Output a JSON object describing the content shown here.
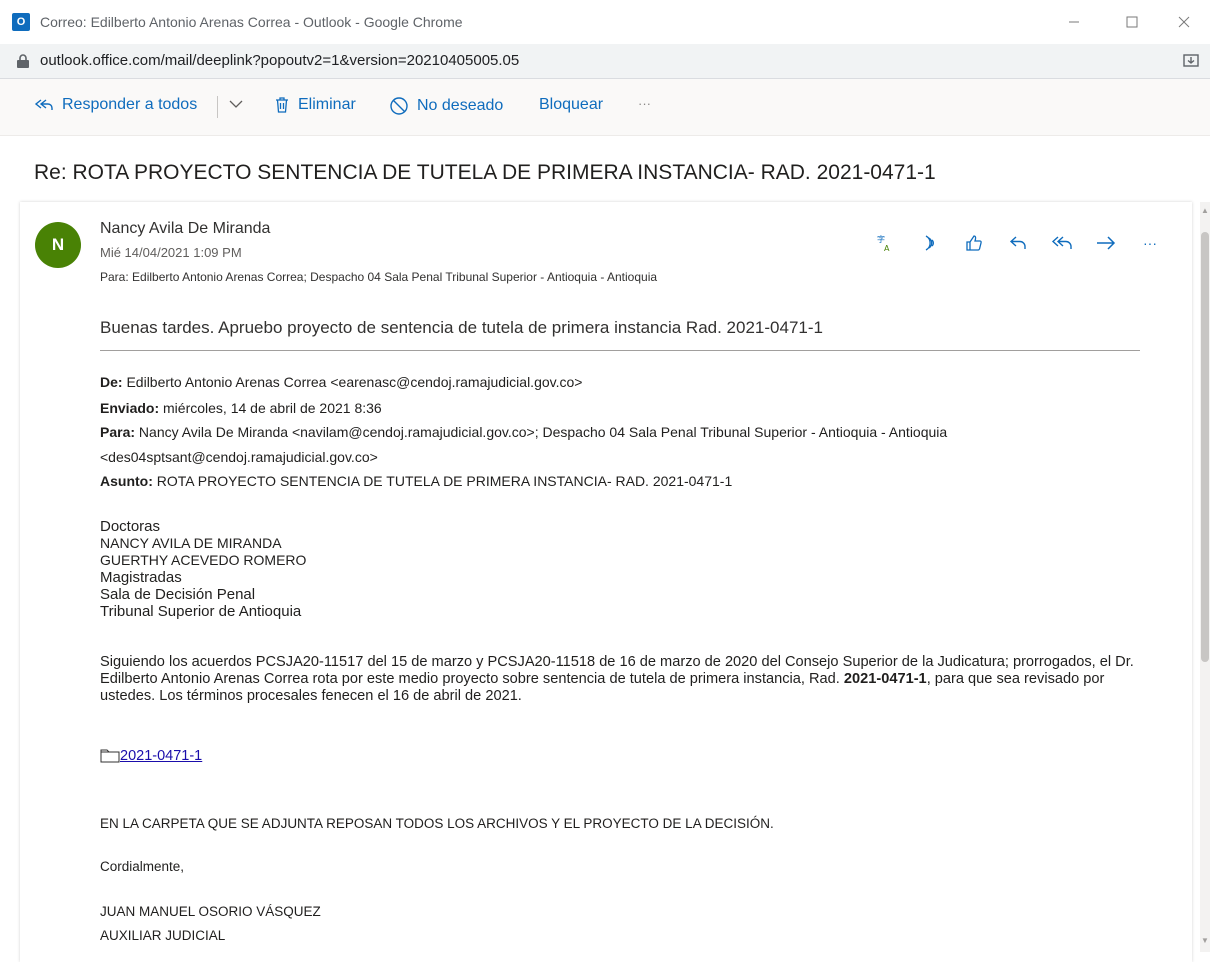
{
  "window": {
    "title": "Correo: Edilberto Antonio Arenas Correa - Outlook - Google Chrome",
    "app_icon_letter": "O"
  },
  "address_bar": {
    "url": "outlook.office.com/mail/deeplink?popoutv2=1&version=20210405005.05"
  },
  "toolbar": {
    "reply_all": "Responder a todos",
    "delete": "Eliminar",
    "junk": "No deseado",
    "block": "Bloquear",
    "more": "···"
  },
  "subject": "Re: ROTA PROYECTO SENTENCIA DE TUTELA DE PRIMERA INSTANCIA- RAD. 2021-0471-1",
  "message": {
    "avatar_initial": "N",
    "sender": "Nancy Avila De Miranda",
    "date": "Mié 14/04/2021 1:09 PM",
    "to_label": "Para:",
    "to_value": "Edilberto Antonio Arenas Correa; Despacho 04 Sala Penal Tribunal Superior - Antioquia - Antioquia",
    "reply_text": "Buenas tardes. Apruebo proyecto de sentencia de tutela de primera instancia Rad. 2021-0471-1",
    "more_actions": "···"
  },
  "quoted": {
    "from_label": "De:",
    "from_value": "Edilberto Antonio Arenas Correa <earenasc@cendoj.ramajudicial.gov.co>",
    "sent_label": "Enviado:",
    "sent_value": "miércoles, 14 de abril de 2021 8:36",
    "to_label": "Para:",
    "to_value": "Nancy Avila De Miranda <navilam@cendoj.ramajudicial.gov.co>; Despacho 04 Sala Penal Tribunal Superior - Antioquia - Antioquia",
    "to_value_2": "<des04sptsant@cendoj.ramajudicial.gov.co>",
    "subject_label": "Asunto:",
    "subject_value": "ROTA PROYECTO SENTENCIA DE TUTELA DE PRIMERA INSTANCIA- RAD. 2021-0471-1"
  },
  "body": {
    "address_lines": [
      "Doctoras",
      "NANCY AVILA DE MIRANDA",
      "GUERTHY ACEVEDO ROMERO",
      "Magistradas",
      "Sala de Decisión Penal",
      "Tribunal Superior de Antioquia"
    ],
    "paragraph_part1": "Siguiendo los acuerdos PCSJA20-11517 del 15 de marzo y PCSJA20-11518 de 16 de marzo de 2020 del Consejo Superior de la Judicatura; prorrogados, el Dr. Edilberto Antonio Arenas Correa rota por este medio proyecto sobre sentencia de tutela de primera instancia, Rad. ",
    "paragraph_bold": "2021-0471-1",
    "paragraph_part2": ", para que sea revisado por ustedes. Los términos procesales fenecen el 16 de abril de 2021.",
    "folder_link": "2021-0471-1",
    "notice": "EN LA CARPETA QUE SE ADJUNTA REPOSAN TODOS LOS ARCHIVOS Y EL PROYECTO DE LA DECISIÓN.",
    "closing": "Cordialmente,",
    "signature_name": "JUAN MANUEL OSORIO VÁSQUEZ",
    "signature_title": "AUXILIAR JUDICIAL"
  },
  "colors": {
    "accent": "#0f6cbd",
    "avatar": "#498205",
    "link": "#1a0dab"
  }
}
